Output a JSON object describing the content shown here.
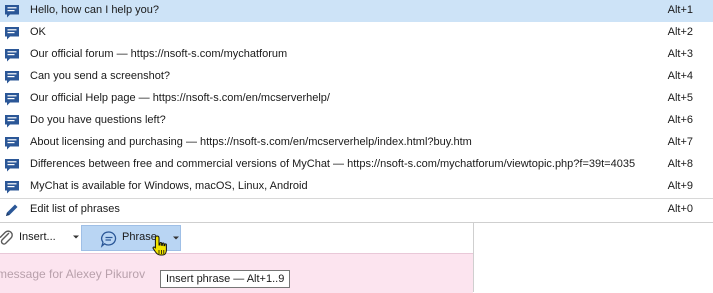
{
  "phrases": [
    {
      "label": "Hello, how can I help you?",
      "shortcut": "Alt+1"
    },
    {
      "label": "OK",
      "shortcut": "Alt+2"
    },
    {
      "label": "Our official forum — https://nsoft-s.com/mychatforum",
      "shortcut": "Alt+3"
    },
    {
      "label": "Can you send a screenshot?",
      "shortcut": "Alt+4"
    },
    {
      "label": "Our official Help page — https://nsoft-s.com/en/mcserverhelp/",
      "shortcut": "Alt+5"
    },
    {
      "label": "Do you have questions left?",
      "shortcut": "Alt+6"
    },
    {
      "label": "About licensing and purchasing — https://nsoft-s.com/en/mcserverhelp/index.html?buy.htm",
      "shortcut": "Alt+7"
    },
    {
      "label": "Differences between free and commercial versions of MyChat — https://nsoft-s.com/mychatforum/viewtopic.php?f=39t=4035",
      "shortcut": "Alt+8"
    },
    {
      "label": "MyChat is available for Windows, macOS, Linux, Android",
      "shortcut": "Alt+9"
    }
  ],
  "edit_item": {
    "label": "Edit list of phrases",
    "shortcut": "Alt+0"
  },
  "toolbar": {
    "insert_label": "Insert...",
    "phrase_label": "Phrase"
  },
  "input": {
    "placeholder": "message for Alexey Pikurov"
  },
  "tooltip": {
    "text": "Insert phrase — Alt+1..9"
  },
  "colors": {
    "selected": "#cde3f7",
    "phrase_button": "#b9d5f3",
    "input_bg": "#fce4ef",
    "icon": "#2b5797"
  }
}
